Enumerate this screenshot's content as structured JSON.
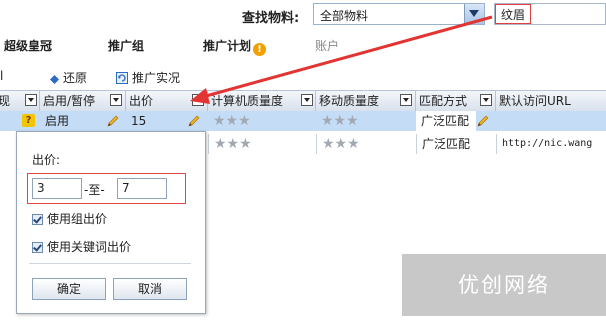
{
  "search": {
    "label": "查找物料:",
    "material_selected": "全部物料",
    "keyword_value": "纹眉"
  },
  "nav": {
    "tabs": [
      {
        "label": "超级皇冠"
      },
      {
        "label": "推广组"
      },
      {
        "label": "推广计划"
      },
      {
        "label": "账户"
      }
    ],
    "info_icon": "!"
  },
  "toolbar": {
    "edge_label": "l",
    "restore_label": "还原",
    "promo_status_label": "推广实况"
  },
  "grid": {
    "columns": [
      {
        "label": "表现"
      },
      {
        "label": "启用/暂停"
      },
      {
        "label": "出价"
      },
      {
        "label": "计算机质量度"
      },
      {
        "label": "移动质量度"
      },
      {
        "label": "匹配方式"
      },
      {
        "label": "默认访问URL"
      }
    ],
    "rows": [
      {
        "perf": "?",
        "status": "启用",
        "bid": "15",
        "pc_stars": "★★★",
        "mobile_stars": "★★★",
        "match": "广泛匹配",
        "url": ""
      },
      {
        "perf": "",
        "status": "",
        "bid": "",
        "pc_stars": "★★★",
        "mobile_stars": "★★★",
        "match": "广泛匹配",
        "url": "http://nic.wang"
      }
    ]
  },
  "popup": {
    "title": "出价:",
    "min_value": "3",
    "separator": "-至-",
    "max_value": "7",
    "use_group_bid_label": "使用组出价",
    "use_keyword_bid_label": "使用关键词出价",
    "confirm_label": "确定",
    "cancel_label": "取消"
  },
  "watermark": {
    "text": "优创网络"
  },
  "colors": {
    "selected_row": "#c5dcf7",
    "highlight_red": "#e04040",
    "watermark_bg": "#c8c8c8"
  }
}
